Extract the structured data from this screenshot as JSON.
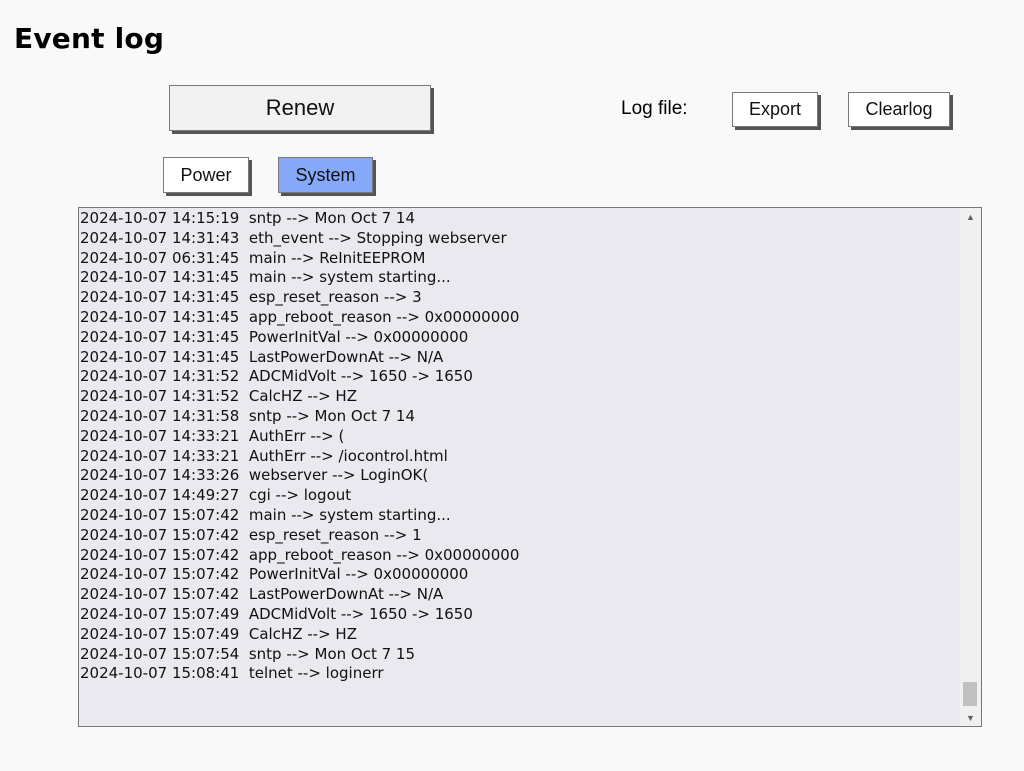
{
  "page": {
    "title": "Event log"
  },
  "toolbar": {
    "renew_label": "Renew",
    "logfile_label": "Log file:",
    "export_label": "Export",
    "clearlog_label": "Clearlog"
  },
  "tabs": [
    {
      "label": "Power",
      "active": false
    },
    {
      "label": "System",
      "active": true
    }
  ],
  "colors": {
    "active_tab": "#85a9f8",
    "log_background": "#e9e9ef"
  },
  "log": {
    "lines": [
      "2024-10-07 14:15:19  sntp --> Mon Oct 7 14",
      "2024-10-07 14:31:43  eth_event --> Stopping webserver",
      "2024-10-07 06:31:45  main --> ReInitEEPROM",
      "2024-10-07 14:31:45  main --> system starting...",
      "2024-10-07 14:31:45  esp_reset_reason --> 3",
      "2024-10-07 14:31:45  app_reboot_reason --> 0x00000000",
      "2024-10-07 14:31:45  PowerInitVal --> 0x00000000",
      "2024-10-07 14:31:45  LastPowerDownAt --> N/A",
      "2024-10-07 14:31:52  ADCMidVolt --> 1650 -> 1650",
      "2024-10-07 14:31:52  CalcHZ --> HZ",
      "2024-10-07 14:31:58  sntp --> Mon Oct 7 14",
      "2024-10-07 14:33:21  AuthErr --> (",
      "2024-10-07 14:33:21  AuthErr --> /iocontrol.html",
      "2024-10-07 14:33:26  webserver --> LoginOK(",
      "2024-10-07 14:49:27  cgi --> logout",
      "2024-10-07 15:07:42  main --> system starting...",
      "2024-10-07 15:07:42  esp_reset_reason --> 1",
      "2024-10-07 15:07:42  app_reboot_reason --> 0x00000000",
      "2024-10-07 15:07:42  PowerInitVal --> 0x00000000",
      "2024-10-07 15:07:42  LastPowerDownAt --> N/A",
      "2024-10-07 15:07:49  ADCMidVolt --> 1650 -> 1650",
      "2024-10-07 15:07:49  CalcHZ --> HZ",
      "2024-10-07 15:07:54  sntp --> Mon Oct 7 15",
      "2024-10-07 15:08:41  telnet --> loginerr"
    ],
    "scroll_position": 0.95
  }
}
